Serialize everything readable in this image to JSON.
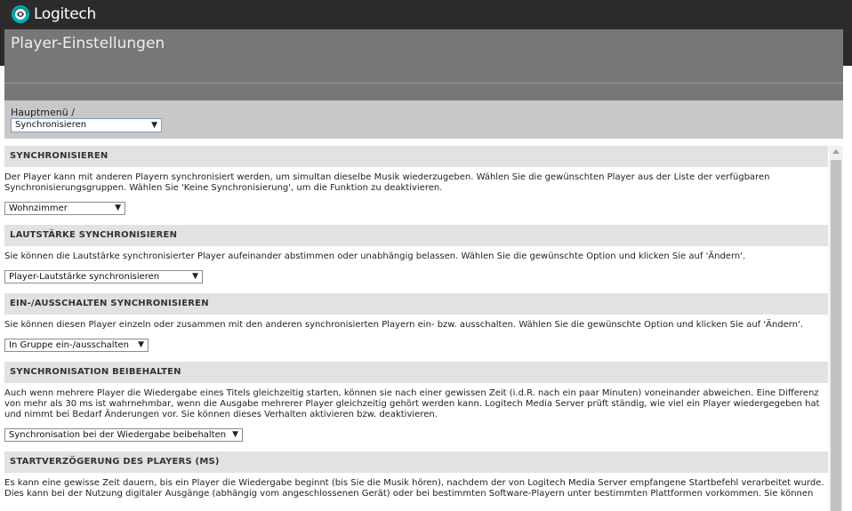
{
  "brand": {
    "name": "Logitech",
    "accent_color": "#00b0b9",
    "icon": "logitech-logo-icon"
  },
  "title": "Player-Einstellungen",
  "breadcrumb": {
    "label": "Hauptmenü /",
    "select_value": "Synchronisieren"
  },
  "sections": [
    {
      "heading": "SYNCHRONISIEREN",
      "description": "Der Player kann mit anderen Playern synchronisiert werden, um simultan dieselbe Musik wiederzugeben. Wählen Sie die gewünschten Player aus der Liste der verfügbaren Synchronisierungsgruppen. Wählen Sie 'Keine Synchronisierung', um die Funktion zu deaktivieren.",
      "select_value": "Wohnzimmer"
    },
    {
      "heading": "LAUTSTÄRKE SYNCHRONISIEREN",
      "description": "Sie können die Lautstärke synchronisierter Player aufeinander abstimmen oder unabhängig belassen. Wählen Sie die gewünschte Option und klicken Sie auf 'Ändern'.",
      "select_value": "Player-Lautstärke synchronisieren"
    },
    {
      "heading": "EIN-/AUSSCHALTEN SYNCHRONISIEREN",
      "description": "Sie können diesen Player einzeln oder zusammen mit den anderen synchronisierten Playern ein- bzw. ausschalten. Wählen Sie die gewünschte Option und klicken Sie auf 'Ändern'.",
      "select_value": "In Gruppe ein-/ausschalten"
    },
    {
      "heading": "SYNCHRONISATION BEIBEHALTEN",
      "description": "Auch wenn mehrere Player die Wiedergabe eines Titels gleichzeitig starten, können sie nach einer gewissen Zeit (i.d.R. nach ein paar Minuten) voneinander abweichen. Eine Differenz von mehr als 30 ms ist wahrnehmbar, wenn die Ausgabe mehrerer Player gleichzeitig gehört werden kann. Logitech Media Server prüft ständig, wie viel ein Player wiedergegeben hat und nimmt bei Bedarf Änderungen vor. Sie können dieses Verhalten aktivieren bzw. deaktivieren.",
      "select_value": "Synchronisation bei der Wiedergabe beibehalten"
    },
    {
      "heading": "STARTVERZÖGERUNG DES PLAYERS (MS)",
      "description": "Es kann eine gewisse Zeit dauern, bis ein Player die Wiedergabe beginnt (bis Sie die Musik hören), nachdem der von Logitech Media Server empfangene Startbefehl verarbeitet wurde. Dies kann bei der Nutzung digitaler Ausgänge (abhängig vom angeschlossenen Gerät) oder bei bestimmten Software-Playern unter bestimmten Plattformen vorkommen. Sie können"
    }
  ],
  "icons": {
    "dropdown": "dropdown-arrow-icon",
    "scroll_up": "scroll-up-icon"
  }
}
